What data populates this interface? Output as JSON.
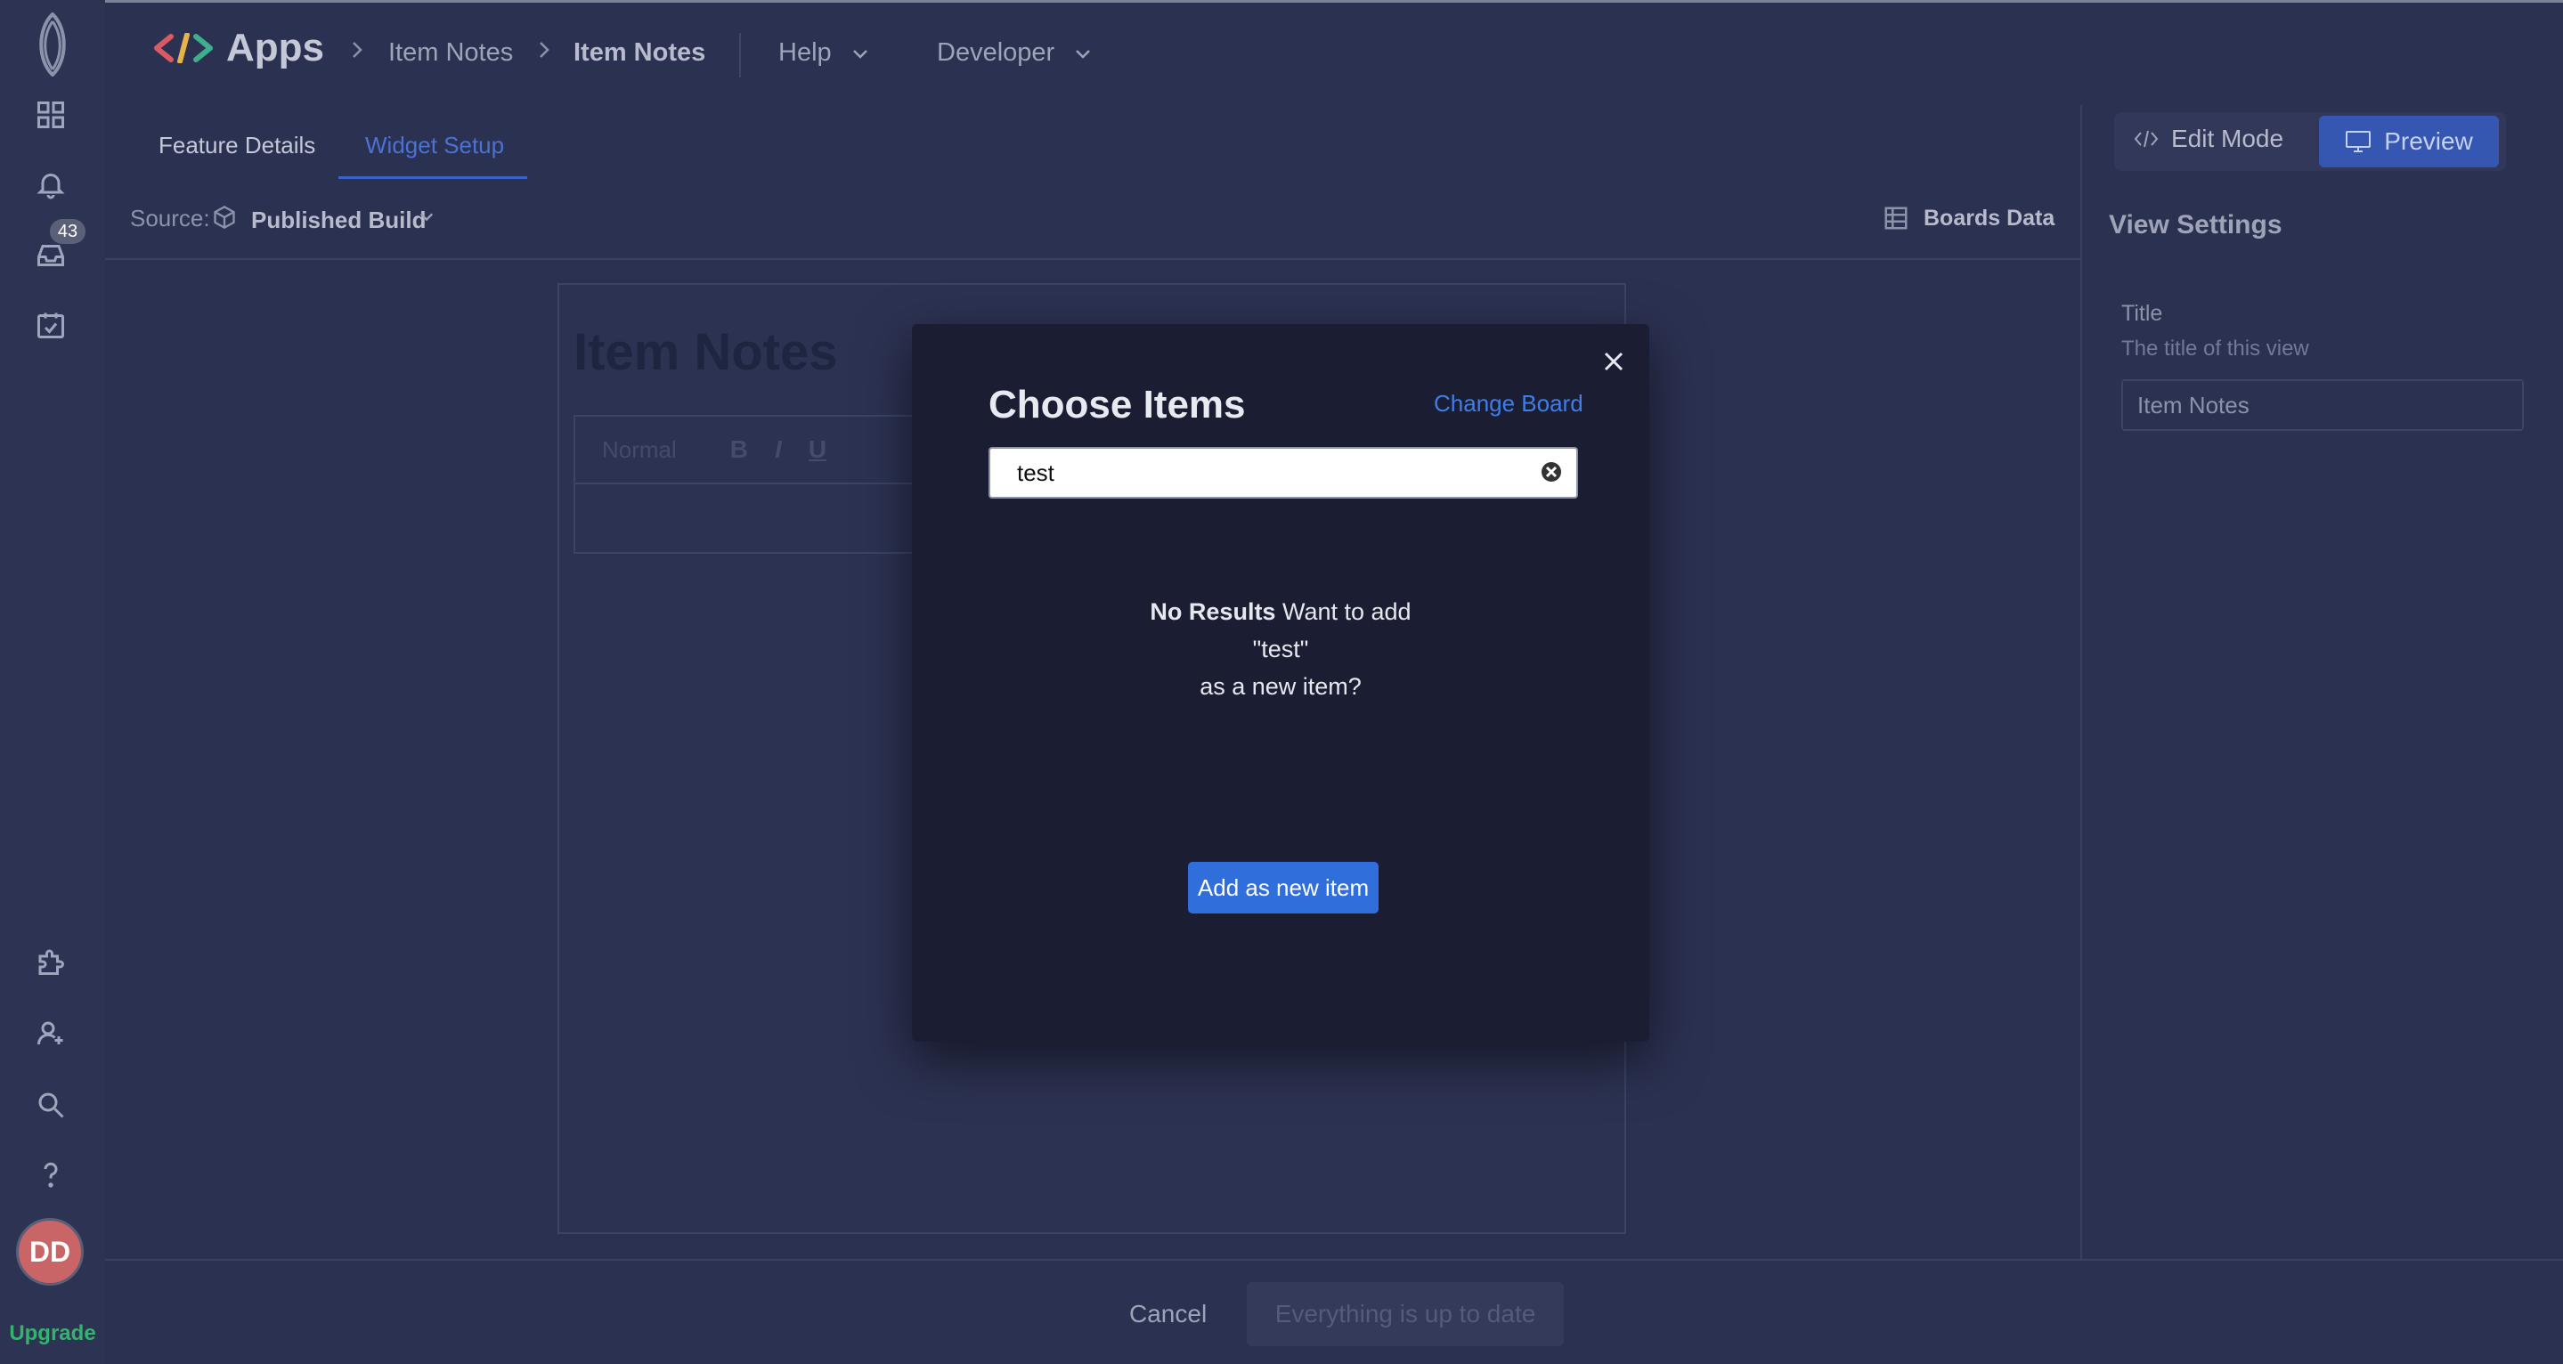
{
  "rail": {
    "badge": "43",
    "avatar_initials": "DD",
    "upgrade": "Upgrade",
    "icons": [
      "logo-icon",
      "grid-icon",
      "bell-icon",
      "inbox-icon",
      "calendar-check-icon",
      "puzzle-icon",
      "user-plus-icon",
      "search-icon",
      "help-icon"
    ]
  },
  "header": {
    "app_name": "Apps",
    "breadcrumb": [
      "Item Notes",
      "Item Notes"
    ],
    "menus": [
      "Help",
      "Developer"
    ]
  },
  "tabs": [
    {
      "label": "Feature Details",
      "active": false
    },
    {
      "label": "Widget Setup",
      "active": true
    }
  ],
  "source": {
    "label": "Source:",
    "value": "Published Build",
    "boards_data": "Boards Data"
  },
  "canvas": {
    "title": "Item Notes",
    "toolbar": {
      "style": "Normal",
      "bold": "B",
      "italic": "I",
      "underline": "U"
    }
  },
  "mode": {
    "edit": "Edit Mode",
    "preview": "Preview"
  },
  "view_settings": {
    "title": "View Settings",
    "field_label": "Title",
    "field_help": "The title of this view",
    "field_value": "Item Notes"
  },
  "footer": {
    "cancel": "Cancel",
    "status": "Everything is up to date"
  },
  "modal": {
    "title": "Choose Items",
    "change_board": "Change Board",
    "search_value": "test",
    "no_results_bold": "No Results",
    "no_results_line1": "Want to add",
    "no_results_term": "\"test\"",
    "no_results_line3": "as a new item?",
    "add_button": "Add as new item"
  },
  "colors": {
    "background": "#2b3151",
    "modal_bg": "#1b1e33",
    "accent": "#2f6edb",
    "link": "#3f7ee8",
    "active_tab": "#4a72d4",
    "upgrade": "#34b36f",
    "avatar": "#c96567"
  }
}
